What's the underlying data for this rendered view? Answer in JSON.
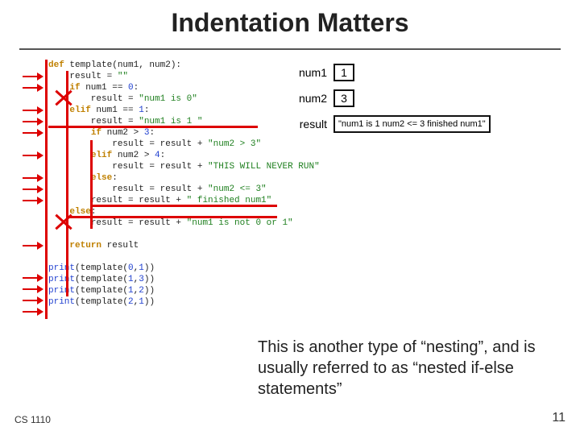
{
  "title": "Indentation Matters",
  "vars": {
    "num1": {
      "label": "num1",
      "value": "1"
    },
    "num2": {
      "label": "num2",
      "value": "3"
    },
    "result": {
      "label": "result",
      "value": "\"num1 is 1 num2 <= 3 finished num1\""
    }
  },
  "code": {
    "l01a": "def",
    "l01b": " template(num1, num2):",
    "l02a": "    result = ",
    "l02b": "\"\"",
    "l03a": "    ",
    "l03b": "if",
    "l03c": " num1 == ",
    "l03d": "0",
    "l03e": ":",
    "l04a": "        result = ",
    "l04b": "\"num1 is 0\"",
    "l05a": "    ",
    "l05b": "elif",
    "l05c": " num1 == ",
    "l05d": "1",
    "l05e": ":",
    "l06a": "        result = ",
    "l06b": "\"num1 is 1 \"",
    "l07a": "        ",
    "l07b": "if",
    "l07c": " num2 > ",
    "l07d": "3",
    "l07e": ":",
    "l08a": "            result = result + ",
    "l08b": "\"num2 > 3\"",
    "l09a": "        ",
    "l09b": "elif",
    "l09c": " num2 > ",
    "l09d": "4",
    "l09e": ":",
    "l10a": "            result = result + ",
    "l10b": "\"THIS WILL NEVER RUN\"",
    "l11a": "        ",
    "l11b": "else",
    "l11c": ":",
    "l12a": "            result = result + ",
    "l12b": "\"num2 <= 3\"",
    "l13a": "        result = result + ",
    "l13b": "\" finished num1\"",
    "l14a": "    ",
    "l14b": "else",
    "l14c": ":",
    "l15a": "        result = result + ",
    "l15b": "\"num1 is not 0 or 1\"",
    "l16": " ",
    "l17a": "    ",
    "l17b": "return",
    "l17c": " result",
    "l18": " ",
    "p1a": "print",
    "p1b": "(template(",
    "p1c": "0",
    "p1d": ",",
    "p1e": "1",
    "p1f": "))",
    "p2a": "print",
    "p2b": "(template(",
    "p2c": "1",
    "p2d": ",",
    "p2e": "3",
    "p2f": "))",
    "p3a": "print",
    "p3b": "(template(",
    "p3c": "1",
    "p3d": ",",
    "p3e": "2",
    "p3f": "))",
    "p4a": "print",
    "p4b": "(template(",
    "p4c": "2",
    "p4d": ",",
    "p4e": "1",
    "p4f": "))"
  },
  "note": "This is another type of “nesting”, and is usually referred to as “nested if-else statements”",
  "footer": {
    "left": "CS 1110",
    "right": "11"
  }
}
